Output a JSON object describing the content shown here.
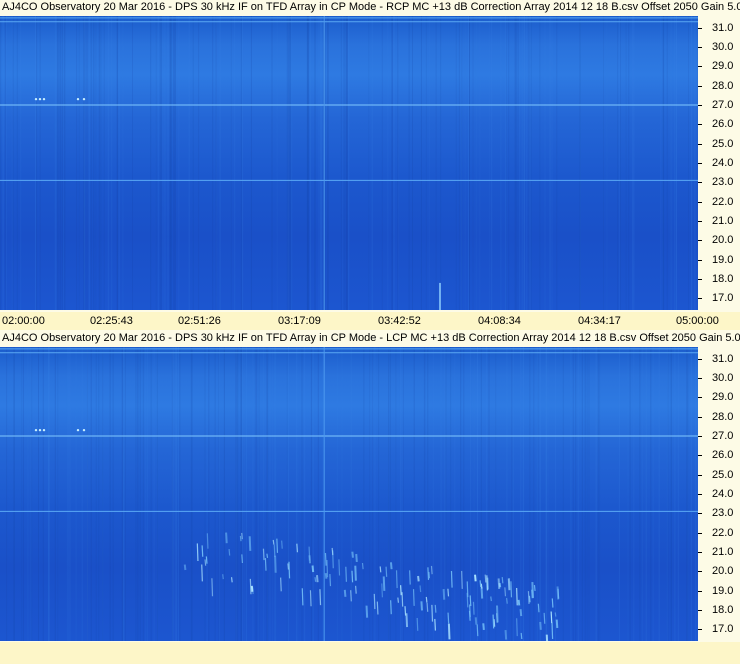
{
  "panels": [
    {
      "title": "AJ4CO Observatory 20 Mar 2016 - DPS 30 kHz IF on TFD Array in CP Mode - RCP  MC +13 dB  Correction Array 2014 12 18 B.csv  Offset 2050  Gain 5.0",
      "polarization": "RCP"
    },
    {
      "title": "AJ4CO Observatory 20 Mar 2016 - DPS 30 kHz IF on TFD Array in CP Mode - LCP  MC +13 dB  Correction Array 2014 12 18 B.csv  Offset 2050  Gain 5.0",
      "polarization": "LCP"
    }
  ],
  "time_labels": [
    "02:00:00",
    "02:25:43",
    "02:51:26",
    "03:17:09",
    "03:42:52",
    "04:08:34",
    "04:34:17",
    "05:00:00"
  ],
  "chart_data": [
    {
      "type": "heatmap",
      "title": "AJ4CO Observatory 20 Mar 2016 - DPS 30 kHz IF on TFD Array in CP Mode - RCP  MC +13 dB  Correction Array 2014 12 18 B.csv  Offset 2050  Gain 5.0",
      "x_ticks": [
        "02:00:00",
        "02:25:43",
        "02:51:26",
        "03:17:09",
        "03:42:52",
        "04:08:34",
        "04:34:17",
        "05:00:00"
      ],
      "y_ticks": [
        31.0,
        30.0,
        29.0,
        28.0,
        27.0,
        26.0,
        25.0,
        24.0,
        23.0,
        22.0,
        21.0,
        20.0,
        19.0,
        18.0,
        17.0
      ],
      "xlim": [
        "02:00:00",
        "05:00:00"
      ],
      "ylim": [
        16.4,
        31.6
      ],
      "colors": {
        "low": "#1a4fc4",
        "high": "#8fd8ff"
      },
      "horizontal_lines_y": [
        31.5,
        31.3,
        27.0,
        23.1
      ],
      "vertical_lines_x": [
        "03:17:09"
      ]
    },
    {
      "type": "heatmap",
      "title": "AJ4CO Observatory 20 Mar 2016 - DPS 30 kHz IF on TFD Array in CP Mode - LCP  MC +13 dB  Correction Array 2014 12 18 B.csv  Offset 2050  Gain 5.0",
      "x_ticks": [
        "02:00:00",
        "02:25:43",
        "02:51:26",
        "03:17:09",
        "03:42:52",
        "04:08:34",
        "04:34:17",
        "05:00:00"
      ],
      "y_ticks": [
        31.0,
        30.0,
        29.0,
        28.0,
        27.0,
        26.0,
        25.0,
        24.0,
        23.0,
        22.0,
        21.0,
        20.0,
        19.0,
        18.0,
        17.0
      ],
      "xlim": [
        "02:00:00",
        "05:00:00"
      ],
      "ylim": [
        16.4,
        31.6
      ],
      "colors": {
        "low": "#1a4fc4",
        "high": "#8fd8ff"
      },
      "horizontal_lines_y": [
        31.5,
        31.3,
        27.0,
        23.1
      ],
      "vertical_lines_x": [
        "03:17:09"
      ]
    }
  ]
}
